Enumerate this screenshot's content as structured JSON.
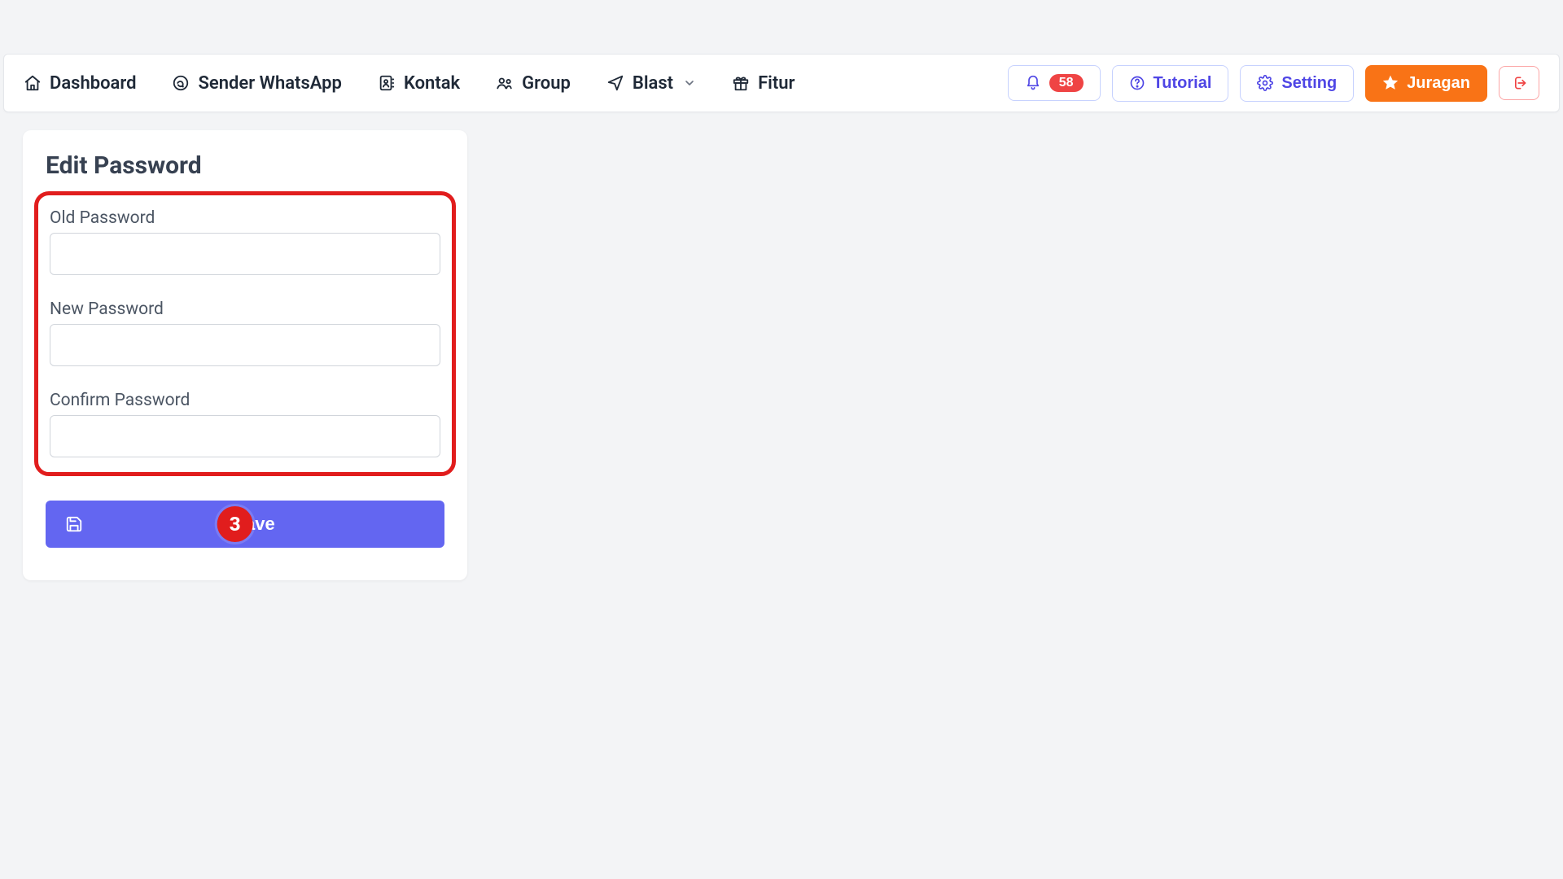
{
  "nav": {
    "dashboard": "Dashboard",
    "sender": "Sender WhatsApp",
    "kontak": "Kontak",
    "group": "Group",
    "blast": "Blast",
    "fitur": "Fitur"
  },
  "topbar": {
    "notif_count": "58",
    "tutorial": "Tutorial",
    "setting": "Setting",
    "juragan": "Juragan"
  },
  "card": {
    "title": "Edit Password",
    "old_label": "Old Password",
    "new_label": "New Password",
    "confirm_label": "Confirm Password",
    "save_label": "Save",
    "step_badge": "3"
  }
}
